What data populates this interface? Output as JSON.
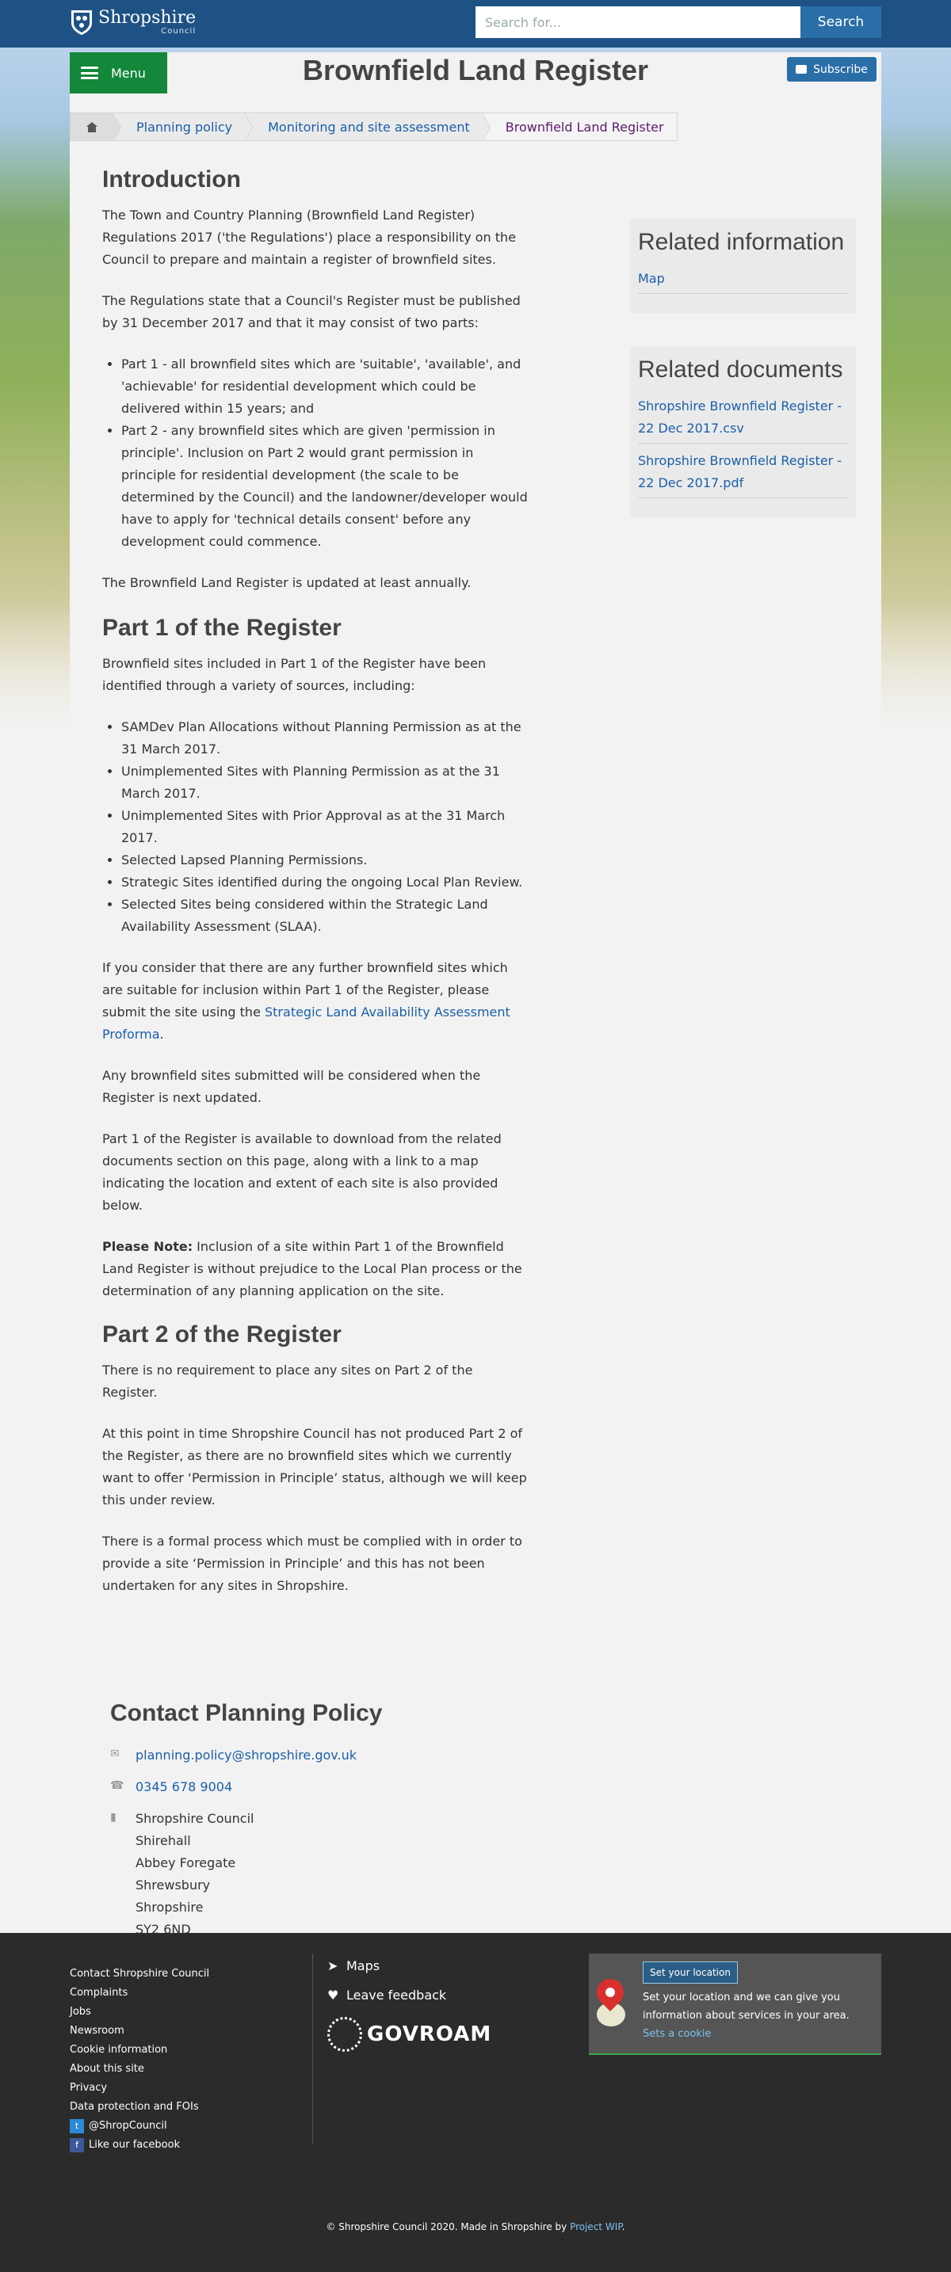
{
  "header": {
    "logo_main": "Shropshire",
    "logo_sub": "Council",
    "search_placeholder": "Search for...",
    "search_button": "Search"
  },
  "page": {
    "menu_label": "Menu",
    "title": "Brownfield Land Register",
    "subscribe_label": "Subscribe"
  },
  "breadcrumb": {
    "items": [
      "Planning policy",
      "Monitoring and site assessment",
      "Brownfield Land Register"
    ]
  },
  "main": {
    "intro_heading": "Introduction",
    "intro_p1": "The Town and Country Planning (Brownfield Land Register) Regulations 2017 ('the Regulations') place a responsibility on the Council to prepare and maintain a register of brownfield sites.",
    "intro_p2": "The Regulations state that a Council's Register must be published by 31 December 2017 and that it may consist of two parts:",
    "intro_list": [
      "Part 1 - all brownfield sites which are 'suitable', 'available', and 'achievable' for residential development which could be delivered within 15 years; and",
      "Part 2 - any brownfield sites which are given 'permission in principle'. Inclusion on Part 2 would grant permission in principle for residential development (the scale to be determined by the Council) and the landowner/developer would have to apply for 'technical details consent' before any development could commence."
    ],
    "intro_p3": "The Brownfield Land Register is updated at least annually.",
    "part1_heading": "Part 1 of the Register",
    "part1_p1": "Brownfield sites included in Part 1 of the Register have been identified through a variety of sources, including:",
    "part1_list": [
      "SAMDev Plan Allocations without Planning Permission as at the 31 March 2017.",
      "Unimplemented Sites with Planning Permission as at the 31 March 2017.",
      "Unimplemented Sites with Prior Approval as at the 31 March 2017.",
      "Selected Lapsed Planning Permissions.",
      "Strategic Sites identified during the ongoing Local Plan Review.",
      "Selected Sites being considered within the Strategic Land Availability Assessment (SLAA)."
    ],
    "part1_p2_before": "If you consider that there are any further brownfield sites which are suitable for inclusion within Part 1 of the Register, please submit the site using the ",
    "part1_p2_link": "Strategic Land Availability Assessment Proforma",
    "part1_p2_after": ".",
    "part1_p3": "Any brownfield sites submitted will be considered when the Register is next updated.",
    "part1_p4": "Part 1 of the Register is available to download from the related documents section on this page, along with a link to a map indicating the location and extent of each site is also provided below.",
    "part1_note_label": "Please Note:",
    "part1_note_text": " Inclusion of a site within Part 1 of the Brownfield Land Register is without prejudice to the Local Plan process or the determination of any planning application on the site.",
    "part2_heading": "Part 2 of the Register",
    "part2_p1": "There is no requirement to place any sites on Part 2 of the Register.",
    "part2_p2": "At this point in time Shropshire Council has not produced Part 2 of the Register, as there are no brownfield sites which we currently want to offer ‘Permission in Principle’ status, although we will keep this under review.",
    "part2_p3": "There is a formal process which must be complied with in order to provide a site ‘Permission in Principle’ and this has not been undertaken for any sites in Shropshire."
  },
  "sidebar": {
    "related_info_heading": "Related information",
    "related_info_links": [
      "Map"
    ],
    "related_docs_heading": "Related documents",
    "related_docs_links": [
      "Shropshire Brownfield Register - 22 Dec 2017.csv",
      "Shropshire Brownfield Register - 22 Dec 2017.pdf"
    ]
  },
  "contact": {
    "heading": "Contact Planning Policy",
    "email": "planning.policy@shropshire.gov.uk",
    "phone": "0345 678 9004",
    "address": [
      "Shropshire Council",
      "Shirehall",
      "Abbey Foregate",
      "Shrewsbury",
      "Shropshire",
      "SY2 6ND"
    ]
  },
  "footer": {
    "links": [
      "Contact Shropshire Council",
      "Complaints",
      "Jobs",
      "Newsroom",
      "Cookie information",
      "About this site",
      "Privacy",
      "Data protection and FOIs"
    ],
    "twitter": "@ShropCouncil",
    "facebook": "Like our facebook",
    "maps": "Maps",
    "feedback": "Leave feedback",
    "govroam": "GOVROAM",
    "set_location_button": "Set your location",
    "location_text": "Set your location and we can give you information about services in your area.",
    "cookie_link": "Sets a cookie",
    "copyright_text": "© Shropshire Council 2020. Made in Shropshire by ",
    "copyright_link": "Project WIP",
    "copyright_end": "."
  },
  "colors": {
    "header_blue": "#1e5284",
    "menu_green": "#13873a",
    "link_blue": "#1a5fa8",
    "footer_bg": "#2b2b2b"
  }
}
